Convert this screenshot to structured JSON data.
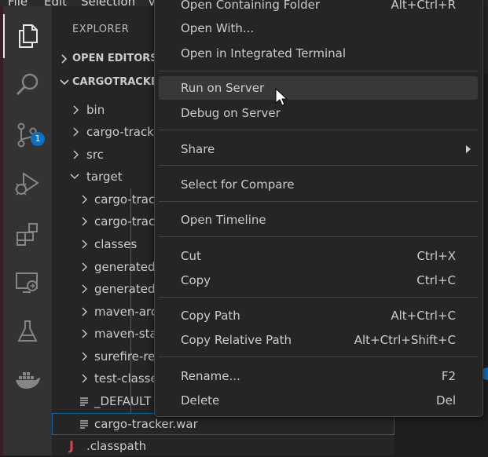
{
  "menubar": {
    "items": [
      "File",
      "Edit",
      "Selection",
      "V"
    ]
  },
  "activity_bar": {
    "items": [
      {
        "name": "files-icon",
        "active": true
      },
      {
        "name": "search-icon"
      },
      {
        "name": "source-control-icon",
        "badge": "1"
      },
      {
        "name": "run-debug-icon"
      },
      {
        "name": "extensions-icon"
      },
      {
        "name": "remote-explorer-icon"
      },
      {
        "name": "testing-icon"
      },
      {
        "name": "docker-icon"
      }
    ]
  },
  "sidebar": {
    "title": "EXPLORER",
    "sections": {
      "open_editors": "OPEN EDITORS",
      "project": "CARGOTRACKER"
    },
    "tree": [
      {
        "label": "bin",
        "type": "folder",
        "depth": 1
      },
      {
        "label": "cargo-track",
        "type": "folder",
        "depth": 1
      },
      {
        "label": "src",
        "type": "folder",
        "depth": 1
      },
      {
        "label": "target",
        "type": "folder-open",
        "depth": 1
      },
      {
        "label": "cargo-track",
        "type": "folder",
        "depth": 2
      },
      {
        "label": "cargo-track",
        "type": "folder",
        "depth": 2
      },
      {
        "label": "classes",
        "type": "folder",
        "depth": 2
      },
      {
        "label": "generated",
        "type": "folder",
        "depth": 2
      },
      {
        "label": "generated",
        "type": "folder",
        "depth": 2
      },
      {
        "label": "maven-arc",
        "type": "folder",
        "depth": 2
      },
      {
        "label": "maven-sta",
        "type": "folder",
        "depth": 2
      },
      {
        "label": "surefire-re",
        "type": "folder",
        "depth": 2
      },
      {
        "label": "test-classe",
        "type": "folder",
        "depth": 2
      },
      {
        "label": "_DEFAULT",
        "type": "file",
        "depth": 2
      },
      {
        "label": "cargo-tracker.war",
        "type": "file",
        "depth": 2,
        "selected": true
      },
      {
        "label": ".classpath",
        "type": "java-file",
        "depth": 1
      }
    ]
  },
  "context_menu": {
    "items": [
      {
        "label": "Open Containing Folder",
        "key": "Alt+Ctrl+R"
      },
      {
        "label": "Open With...",
        "key": ""
      },
      {
        "label": "Open in Integrated Terminal",
        "key": ""
      },
      {
        "label": "Run on Server",
        "key": "",
        "highlighted": true
      },
      {
        "label": "Debug on Server",
        "key": ""
      },
      {
        "label": "Share",
        "key": "",
        "submenu": true
      },
      {
        "label": "Select for Compare",
        "key": ""
      },
      {
        "label": "Open Timeline",
        "key": ""
      },
      {
        "label": "Cut",
        "key": "Ctrl+X"
      },
      {
        "label": "Copy",
        "key": "Ctrl+C"
      },
      {
        "label": "Copy Path",
        "key": "Alt+Ctrl+C"
      },
      {
        "label": "Copy Relative Path",
        "key": "Alt+Ctrl+Shift+C"
      },
      {
        "label": "Rename...",
        "key": "F2"
      },
      {
        "label": "Delete",
        "key": "Del"
      }
    ]
  },
  "colors": {
    "accent": "#0e70c0",
    "menu_bg": "#252526",
    "highlight": "#383838",
    "java": "#e0434c"
  }
}
